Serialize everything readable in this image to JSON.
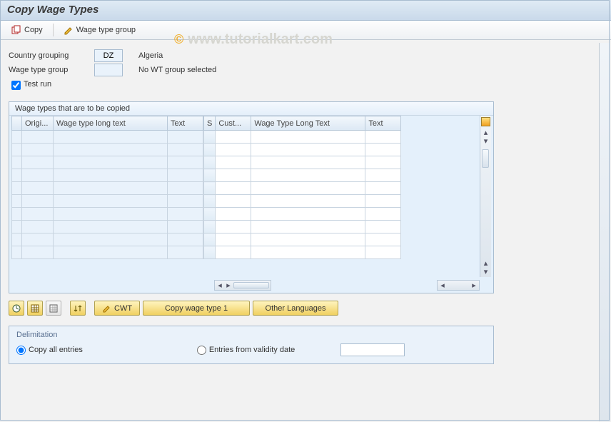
{
  "title": "Copy Wage Types",
  "watermark": "www.tutorialkart.com",
  "toolbar": {
    "copy_label": "Copy",
    "wage_type_group_label": "Wage type group"
  },
  "form": {
    "country_grouping_label": "Country grouping",
    "country_grouping_value": "DZ",
    "country_grouping_text": "Algeria",
    "wage_type_group_label": "Wage type group",
    "wage_type_group_value": "",
    "wage_type_group_text": "No WT group selected",
    "test_run_label": "Test run",
    "test_run_checked": true
  },
  "table": {
    "caption": "Wage types that are to be copied",
    "row_count": 10,
    "left_headers": [
      "Origi...",
      "Wage type long text",
      "Text"
    ],
    "right_headers": [
      "S",
      "Cust...",
      "Wage Type Long Text",
      "Text"
    ]
  },
  "actions": {
    "cwt_label": "CWT",
    "copy_wage_type_1_label": "Copy wage type 1",
    "other_languages_label": "Other Languages"
  },
  "delimitation": {
    "legend": "Delimitation",
    "copy_all_label": "Copy all entries",
    "entries_from_label": "Entries from validity date",
    "validity_date": "",
    "selected": "copy_all"
  }
}
